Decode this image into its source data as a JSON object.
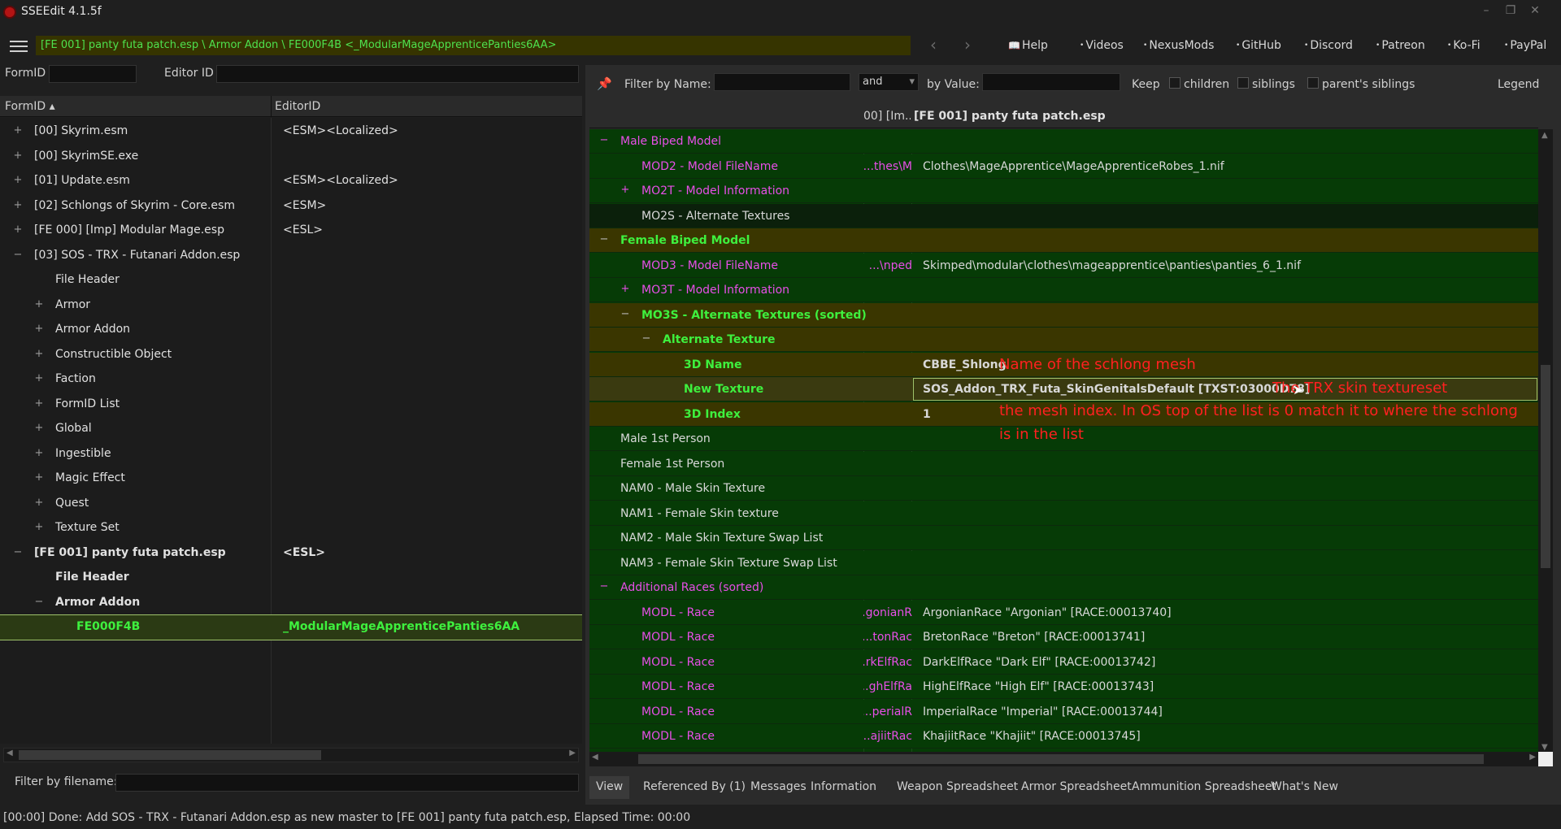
{
  "window": {
    "title": "SSEEdit 4.1.5f"
  },
  "toolbar": {
    "path": "[FE 001] panty futa patch.esp \\ Armor Addon \\ FE000F4B <_ModularMageApprenticePanties6AA>",
    "links": [
      {
        "label": "Help",
        "icon": "book-icon"
      },
      {
        "label": "Videos",
        "icon": "dot-icon"
      },
      {
        "label": "NexusMods",
        "icon": "dot-icon"
      },
      {
        "label": "GitHub",
        "icon": "dot-icon"
      },
      {
        "label": "Discord",
        "icon": "dot-icon"
      },
      {
        "label": "Patreon",
        "icon": "dot-icon"
      },
      {
        "label": "Ko-Fi",
        "icon": "dot-icon"
      },
      {
        "label": "PayPal",
        "icon": "dot-icon"
      }
    ]
  },
  "left": {
    "formid_label": "FormID",
    "editorid_label": "Editor ID",
    "col_formid": "FormID",
    "col_editorid": "EditorID",
    "tree": [
      {
        "exp": "+",
        "indent": 0,
        "label": "[00] Skyrim.esm",
        "editor": "<ESM><Localized>"
      },
      {
        "exp": "+",
        "indent": 0,
        "label": "[00] SkyrimSE.exe",
        "editor": ""
      },
      {
        "exp": "+",
        "indent": 0,
        "label": "[01] Update.esm",
        "editor": "<ESM><Localized>"
      },
      {
        "exp": "+",
        "indent": 0,
        "label": "[02] Schlongs of Skyrim - Core.esm",
        "editor": "<ESM>"
      },
      {
        "exp": "+",
        "indent": 0,
        "label": "[FE 000] [Imp] Modular Mage.esp",
        "editor": "<ESL>"
      },
      {
        "exp": "−",
        "indent": 0,
        "label": "[03] SOS - TRX - Futanari Addon.esp",
        "editor": ""
      },
      {
        "exp": "",
        "indent": 1,
        "label": "File Header",
        "editor": ""
      },
      {
        "exp": "+",
        "indent": 1,
        "label": "Armor",
        "editor": ""
      },
      {
        "exp": "+",
        "indent": 1,
        "label": "Armor Addon",
        "editor": ""
      },
      {
        "exp": "+",
        "indent": 1,
        "label": "Constructible Object",
        "editor": ""
      },
      {
        "exp": "+",
        "indent": 1,
        "label": "Faction",
        "editor": ""
      },
      {
        "exp": "+",
        "indent": 1,
        "label": "FormID List",
        "editor": ""
      },
      {
        "exp": "+",
        "indent": 1,
        "label": "Global",
        "editor": ""
      },
      {
        "exp": "+",
        "indent": 1,
        "label": "Ingestible",
        "editor": ""
      },
      {
        "exp": "+",
        "indent": 1,
        "label": "Magic Effect",
        "editor": ""
      },
      {
        "exp": "+",
        "indent": 1,
        "label": "Quest",
        "editor": ""
      },
      {
        "exp": "+",
        "indent": 1,
        "label": "Texture Set",
        "editor": ""
      },
      {
        "exp": "−",
        "indent": 0,
        "label": "[FE 001] panty futa patch.esp",
        "editor": "<ESL>",
        "bold": true
      },
      {
        "exp": "",
        "indent": 1,
        "label": "File Header",
        "editor": "",
        "bold": true
      },
      {
        "exp": "−",
        "indent": 1,
        "label": "Armor Addon",
        "editor": "",
        "bold": true
      },
      {
        "exp": "",
        "indent": 2,
        "label": "FE000F4B",
        "editor": "_ModularMageApprenticePanties6AA",
        "selected": true
      }
    ],
    "filename_filter_label": "Filter by filename:"
  },
  "right": {
    "filter": {
      "by_name_label": "Filter by Name:",
      "op": "and",
      "by_value_label": "by Value:",
      "keep_label": "Keep",
      "children_label": "children",
      "siblings_label": "siblings",
      "parents_siblings_label": "parent's siblings",
      "legend_label": "Legend"
    },
    "header_mid": "00] [Im...",
    "header_file": "[FE 001] panty futa patch.esp",
    "rows": [
      {
        "exp": "−",
        "indent": 0,
        "name": "Male Biped Model",
        "style": "pink",
        "mid": "",
        "val": "",
        "bg": "green"
      },
      {
        "exp": "",
        "indent": 1,
        "name": "MOD2 - Model FileName",
        "style": "pink",
        "mid": "thes\\M...",
        "val": "Clothes\\MageApprentice\\MageApprenticeRobes_1.nif",
        "bg": "green"
      },
      {
        "exp": "+",
        "indent": 1,
        "name": "MO2T - Model Information",
        "style": "pink",
        "mid": "",
        "val": "",
        "bg": "green"
      },
      {
        "exp": "",
        "indent": 1,
        "name": "MO2S - Alternate Textures",
        "style": "wht",
        "mid": "",
        "val": "",
        "bg": "dark"
      },
      {
        "exp": "−",
        "indent": 0,
        "name": "Female Biped Model",
        "style": "gbright",
        "mid": "",
        "val": "",
        "bg": "olive"
      },
      {
        "exp": "",
        "indent": 1,
        "name": "MOD3 - Model FileName",
        "style": "pink",
        "mid": "nped\\...",
        "val": "Skimped\\modular\\clothes\\mageapprentice\\panties\\panties_6_1.nif",
        "bg": "green"
      },
      {
        "exp": "+",
        "indent": 1,
        "name": "MO3T - Model Information",
        "style": "pink",
        "mid": "",
        "val": "",
        "bg": "green"
      },
      {
        "exp": "−",
        "indent": 1,
        "name": "MO3S - Alternate Textures (sorted)",
        "style": "gbright",
        "mid": "",
        "val": "",
        "bg": "olive"
      },
      {
        "exp": "−",
        "indent": 2,
        "name": "Alternate Texture",
        "style": "gbright",
        "mid": "",
        "val": "",
        "bg": "olive"
      },
      {
        "exp": "",
        "indent": 3,
        "name": "3D Name",
        "style": "gbright",
        "mid": "",
        "val": "CBBE_Shlong",
        "valstyle": "gbright",
        "bg": "olive"
      },
      {
        "exp": "",
        "indent": 3,
        "name": "New Texture",
        "style": "gbright",
        "mid": "",
        "val": "SOS_Addon_TRX_Futa_SkinGenitalsDefault [TXST:03000D78]",
        "valstyle": "gbright",
        "bg": "olive2",
        "selected": true
      },
      {
        "exp": "",
        "indent": 3,
        "name": "3D Index",
        "style": "gbright",
        "mid": "",
        "val": "1",
        "valstyle": "gbright",
        "bg": "olive"
      },
      {
        "exp": "",
        "indent": 0,
        "name": "Male 1st Person",
        "style": "wht",
        "mid": "",
        "val": "",
        "bg": "green"
      },
      {
        "exp": "",
        "indent": 0,
        "name": "Female 1st Person",
        "style": "wht",
        "mid": "",
        "val": "",
        "bg": "green"
      },
      {
        "exp": "",
        "indent": 0,
        "name": "NAM0 - Male Skin Texture",
        "style": "wht",
        "mid": "",
        "val": "",
        "bg": "green"
      },
      {
        "exp": "",
        "indent": 0,
        "name": "NAM1 - Female Skin texture",
        "style": "wht",
        "mid": "",
        "val": "",
        "bg": "green"
      },
      {
        "exp": "",
        "indent": 0,
        "name": "NAM2 - Male Skin Texture Swap List",
        "style": "wht",
        "mid": "",
        "val": "",
        "bg": "green"
      },
      {
        "exp": "",
        "indent": 0,
        "name": "NAM3 - Female Skin Texture Swap List",
        "style": "wht",
        "mid": "",
        "val": "",
        "bg": "green"
      },
      {
        "exp": "−",
        "indent": 0,
        "name": "Additional Races (sorted)",
        "style": "pink",
        "mid": "",
        "val": "",
        "bg": "green"
      },
      {
        "exp": "",
        "indent": 1,
        "name": "MODL - Race",
        "style": "pink",
        "mid": "gonianR...",
        "val": "ArgonianRace \"Argonian\" [RACE:00013740]",
        "bg": "green"
      },
      {
        "exp": "",
        "indent": 1,
        "name": "MODL - Race",
        "style": "pink",
        "mid": "tonRac...",
        "val": "BretonRace \"Breton\" [RACE:00013741]",
        "bg": "green"
      },
      {
        "exp": "",
        "indent": 1,
        "name": "MODL - Race",
        "style": "pink",
        "mid": "rkElfRac...",
        "val": "DarkElfRace \"Dark Elf\" [RACE:00013742]",
        "bg": "green"
      },
      {
        "exp": "",
        "indent": 1,
        "name": "MODL - Race",
        "style": "pink",
        "mid": "ghElfRa...",
        "val": "HighElfRace \"High Elf\" [RACE:00013743]",
        "bg": "green"
      },
      {
        "exp": "",
        "indent": 1,
        "name": "MODL - Race",
        "style": "pink",
        "mid": "perialR...",
        "val": "ImperialRace \"Imperial\" [RACE:00013744]",
        "bg": "green"
      },
      {
        "exp": "",
        "indent": 1,
        "name": "MODL - Race",
        "style": "pink",
        "mid": "ajiitRac...",
        "val": "KhajiitRace \"Khajiit\" [RACE:00013745]",
        "bg": "green"
      }
    ],
    "annotations": {
      "a1": "Name of the schlong mesh",
      "a2": "The TRX skin textureset",
      "a3": "the mesh index. In OS top of the list is 0 match it to where the schlong",
      "a4": "is in the list"
    },
    "tabs": [
      "View",
      "Referenced By (1)",
      "Messages",
      "Information",
      "Weapon Spreadsheet",
      "Armor Spreadsheet",
      "Ammunition Spreadsheet",
      "What's New"
    ]
  },
  "status": "[00:00] Done: Add SOS - TRX - Futanari Addon.esp as new master to [FE 001] panty futa patch.esp, Elapsed Time: 00:00",
  "colors": {
    "green_bg": "#063b06",
    "olive_bg": "#3a3600",
    "pink": "#e84fe8",
    "bright_green": "#3ef03e",
    "annotation_red": "#ff2020"
  }
}
